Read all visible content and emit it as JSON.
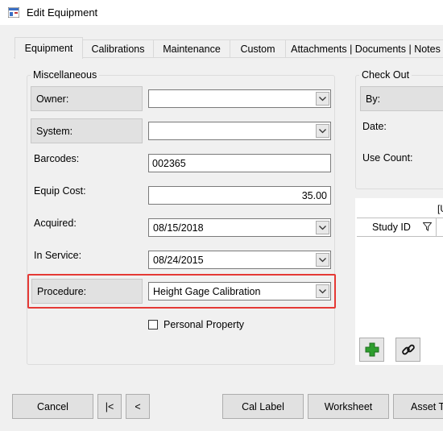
{
  "window": {
    "title": "Edit Equipment"
  },
  "tabs": [
    {
      "label": "Equipment"
    },
    {
      "label": "Calibrations"
    },
    {
      "label": "Maintenance"
    },
    {
      "label": "Custom"
    },
    {
      "label": "Attachments | Documents | Notes"
    }
  ],
  "misc": {
    "title": "Miscellaneous",
    "owner_label": "Owner:",
    "owner_value": "",
    "system_label": "System:",
    "system_value": "",
    "barcodes_label": "Barcodes:",
    "barcodes_value": "002365",
    "cost_label": "Equip Cost:",
    "cost_value": "35.00",
    "acquired_label": "Acquired:",
    "acquired_value": "08/15/2018",
    "inservice_label": "In Service:",
    "inservice_value": "08/24/2015",
    "procedure_label": "Procedure:",
    "procedure_value": "Height Gage Calibration",
    "personal_label": "Personal Property",
    "personal_checked": false
  },
  "checkout": {
    "title": "Check Out",
    "by_label": "By:",
    "date_label": "Date:",
    "usecount_label": "Use Count:"
  },
  "grid": {
    "top_label": "[U",
    "col_study_id": "Study ID"
  },
  "buttons": {
    "cancel": "Cancel",
    "first": "|<",
    "prev": "<",
    "cal_label": "Cal Label",
    "worksheet": "Worksheet",
    "asset_tag": "Asset Ta"
  },
  "colors": {
    "highlight": "#e53935",
    "add_icon": "#2e9e2e"
  }
}
